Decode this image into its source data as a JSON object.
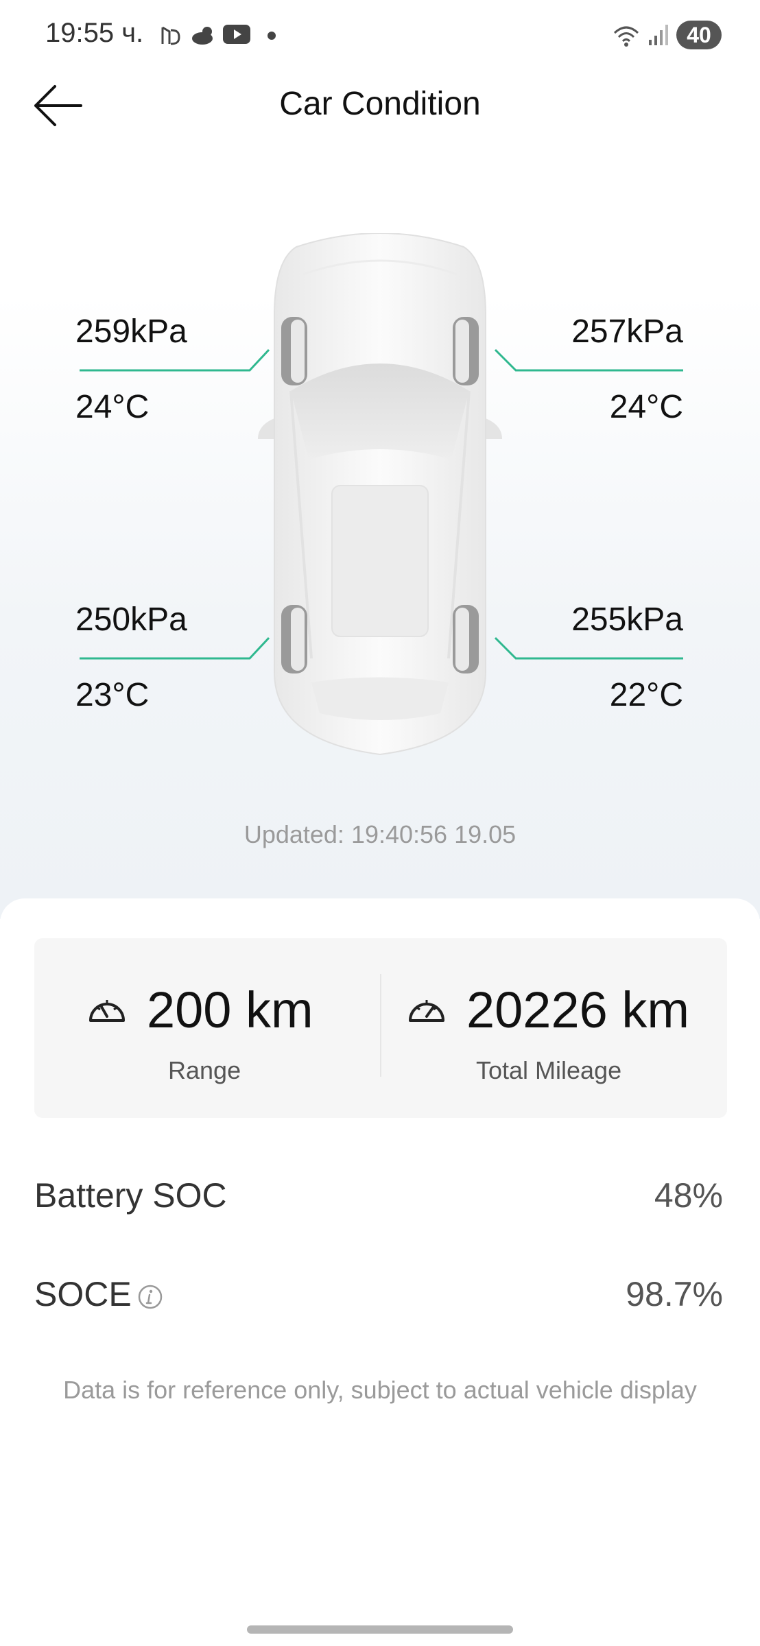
{
  "status_bar": {
    "time": "19:55 ч.",
    "battery": "40",
    "icons": [
      "nfc-icon",
      "weather-cloud-sun-icon",
      "youtube-icon",
      "dot-icon",
      "wifi-icon",
      "signal-icon"
    ]
  },
  "header": {
    "title": "Car Condition",
    "back_icon": "arrow-left-icon"
  },
  "tires": {
    "front_left": {
      "pressure": "259kPa",
      "temperature": "24°C"
    },
    "front_right": {
      "pressure": "257kPa",
      "temperature": "24°C"
    },
    "rear_left": {
      "pressure": "250kPa",
      "temperature": "23°C"
    },
    "rear_right": {
      "pressure": "255kPa",
      "temperature": "22°C"
    },
    "leader_color": "#2fb88f"
  },
  "updated": "Updated: 19:40:56 19.05",
  "stats": {
    "range": {
      "value": "200 km",
      "label": "Range",
      "icon": "speedometer-icon"
    },
    "mileage": {
      "value": "20226 km",
      "label": "Total Mileage",
      "icon": "odometer-icon"
    }
  },
  "battery_soc": {
    "label": "Battery SOC",
    "value": "48%"
  },
  "soce": {
    "label": "SOCE",
    "value": "98.7%",
    "icon": "info-icon"
  },
  "disclaimer": "Data is for reference only, subject to actual vehicle display"
}
